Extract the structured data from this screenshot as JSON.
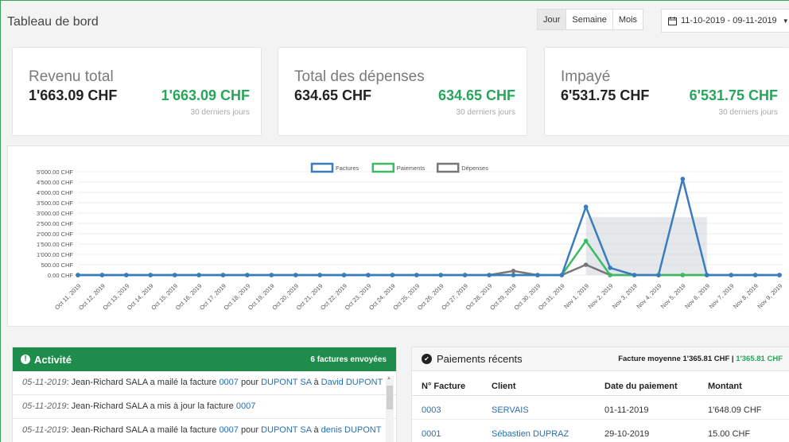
{
  "header": {
    "title": "Tableau de bord",
    "periods": [
      "Jour",
      "Semaine",
      "Mois"
    ],
    "active_period": "Jour",
    "date_range": "11-10-2019 - 09-11-2019"
  },
  "stats": [
    {
      "title": "Revenu total",
      "value": "1'663.09 CHF",
      "value_alt": "1'663.09 CHF",
      "sub": "30 derniers jours"
    },
    {
      "title": "Total des dépenses",
      "value": "634.65 CHF",
      "value_alt": "634.65 CHF",
      "sub": "30 derniers jours"
    },
    {
      "title": "Impayé",
      "value": "6'531.75 CHF",
      "value_alt": "6'531.75 CHF",
      "sub": "30 derniers jours"
    }
  ],
  "chart_data": {
    "type": "line",
    "legend_position": "top",
    "grid": true,
    "ylim": [
      0,
      5000
    ],
    "yticks": [
      "0.00 CHF",
      "500.00 CHF",
      "1'000.00 CHF",
      "1'500.00 CHF",
      "2'000.00 CHF",
      "2'500.00 CHF",
      "3'000.00 CHF",
      "3'500.00 CHF",
      "4'000.00 CHF",
      "4'500.00 CHF",
      "5'000.00 CHF"
    ],
    "categories": [
      "Oct 11, 2019",
      "Oct 12, 2019",
      "Oct 13, 2019",
      "Oct 14, 2019",
      "Oct 15, 2019",
      "Oct 16, 2019",
      "Oct 17, 2019",
      "Oct 18, 2019",
      "Oct 19, 2019",
      "Oct 20, 2019",
      "Oct 21, 2019",
      "Oct 22, 2019",
      "Oct 23, 2019",
      "Oct 24, 2019",
      "Oct 25, 2019",
      "Oct 26, 2019",
      "Oct 27, 2019",
      "Oct 28, 2019",
      "Oct 29, 2019",
      "Oct 30, 2019",
      "Oct 31, 2019",
      "Nov 1, 2019",
      "Nov 2, 2019",
      "Nov 3, 2019",
      "Nov 4, 2019",
      "Nov 5, 2019",
      "Nov 6, 2019",
      "Nov 7, 2019",
      "Nov 8, 2019",
      "Nov 9, 2019"
    ],
    "series": [
      {
        "name": "Factures",
        "color": "#3a7bbf",
        "values": [
          0,
          0,
          0,
          0,
          0,
          0,
          0,
          0,
          0,
          0,
          0,
          0,
          0,
          0,
          0,
          0,
          0,
          0,
          0,
          0,
          0,
          3300,
          350,
          0,
          0,
          4650,
          0,
          0,
          0,
          0
        ]
      },
      {
        "name": "Paiements",
        "color": "#3dbb63",
        "values": [
          0,
          0,
          0,
          0,
          0,
          0,
          0,
          0,
          0,
          0,
          0,
          0,
          0,
          0,
          0,
          0,
          0,
          0,
          0,
          0,
          0,
          1650,
          0,
          0,
          0,
          0,
          0,
          0,
          0,
          0
        ]
      },
      {
        "name": "Dépenses",
        "color": "#777777",
        "values": [
          0,
          0,
          0,
          0,
          0,
          0,
          0,
          0,
          0,
          0,
          0,
          0,
          0,
          0,
          0,
          0,
          0,
          0,
          200,
          0,
          0,
          500,
          0,
          0,
          0,
          0,
          0,
          0,
          0,
          0
        ]
      }
    ]
  },
  "activity": {
    "title": "Activité",
    "count": "6 factures envoyées",
    "items": [
      {
        "date": "05-11-2019",
        "pre": ": Jean-Richard SALA a mailé la facture ",
        "link1": "0007",
        "mid": " pour ",
        "link2": "DUPONT SA",
        "mid2": " à ",
        "link3": "David DUPONT"
      },
      {
        "date": "05-11-2019",
        "pre": ": Jean-Richard SALA a mis à jour la facture ",
        "link1": "0007",
        "mid": "",
        "link2": "",
        "mid2": "",
        "link3": ""
      },
      {
        "date": "05-11-2019",
        "pre": ": Jean-Richard SALA a mailé la facture ",
        "link1": "0007",
        "mid": " pour ",
        "link2": "DUPONT SA",
        "mid2": " à ",
        "link3": "denis DUPONT"
      }
    ]
  },
  "payments": {
    "title": "Paiements récents",
    "avg_label": "Facture moyenne 1'365.81 CHF | ",
    "avg_value": "1'365.81 CHF",
    "columns": [
      "N° Facture",
      "Client",
      "Date du paiement",
      "Montant"
    ],
    "rows": [
      {
        "invoice": "0003",
        "client": "SERVAIS",
        "date": "01-11-2019",
        "amount": "1'648.09 CHF"
      },
      {
        "invoice": "0001",
        "client": "Sébastien DUPRAZ",
        "date": "29-10-2019",
        "amount": "15.00 CHF"
      }
    ]
  },
  "icons": {
    "calendar": "calendar-icon",
    "activity": "exclamation-circle-icon",
    "payments": "check-circle-icon"
  }
}
